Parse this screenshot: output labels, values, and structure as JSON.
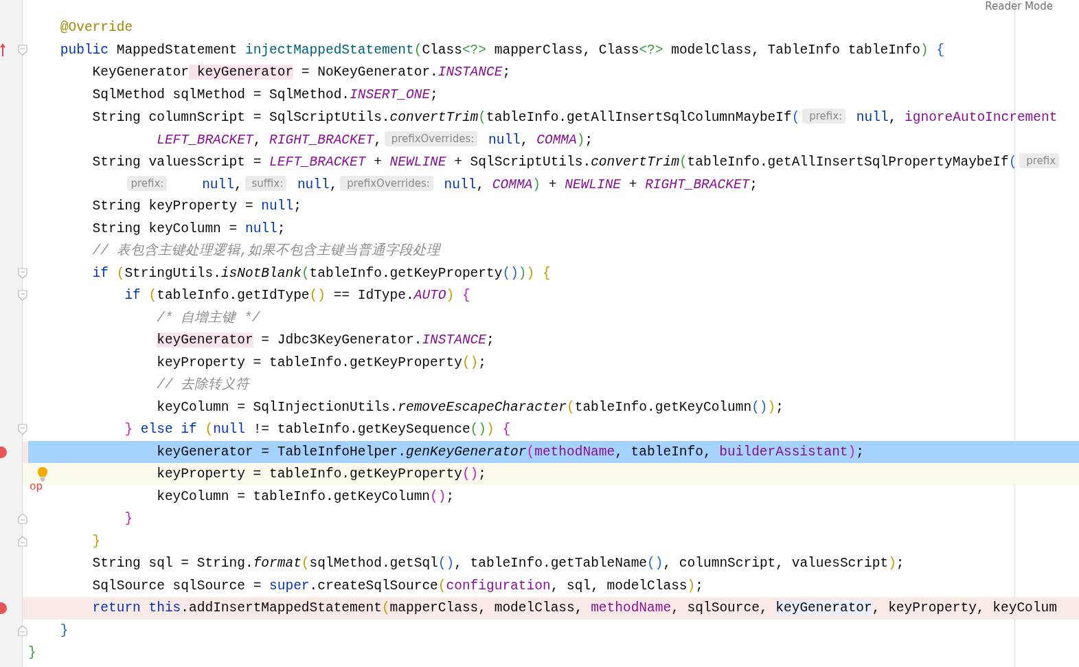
{
  "toolbar": {
    "reader_mode": "Reader Mode"
  },
  "lines": [
    {
      "tokens": [
        {
          "text": "@Override",
          "kind": "annotation"
        }
      ]
    },
    {
      "override": true,
      "fold_start": true,
      "tokens": [
        {
          "text": "public",
          "kind": "keyword"
        },
        {
          "text": " MappedStatement",
          "kind": "plain"
        },
        {
          "text": " injectMappedStatement",
          "kind": "decl"
        },
        {
          "text": "(",
          "kind": "bracket",
          "color": "#3b9c3b"
        },
        {
          "text": "Class",
          "kind": "plain"
        },
        {
          "text": "<?>",
          "kind": "bracket",
          "color": "#3b9c3b"
        },
        {
          "text": " mapperClass, Class",
          "kind": "plain"
        },
        {
          "text": "<?>",
          "kind": "bracket",
          "color": "#3b9c3b"
        },
        {
          "text": " modelClass, TableInfo tableInfo",
          "kind": "plain"
        },
        {
          "text": ")",
          "kind": "bracket",
          "color": "#3b9c3b"
        },
        {
          "text": " {",
          "kind": "bracket",
          "color": "#2060d0"
        }
      ],
      "children": [
        {
          "tokens": [
            {
              "text": "KeyGenerator",
              "kind": "plain"
            },
            {
              "text": " keyGenerator",
              "kind": "write-usage"
            },
            {
              "text": " = NoKeyGenerator.",
              "kind": "plain"
            },
            {
              "text": "INSTANCE",
              "kind": "constant"
            },
            {
              "text": ";",
              "kind": "plain"
            }
          ]
        },
        {
          "tokens": [
            {
              "text": "SqlMethod sqlMethod = SqlMethod.",
              "kind": "plain"
            },
            {
              "text": "INSERT_ONE",
              "kind": "constant"
            },
            {
              "text": ";",
              "kind": "plain"
            }
          ]
        },
        {
          "tokens": [
            {
              "text": "String columnScript = SqlScriptUtils.",
              "kind": "plain"
            },
            {
              "text": "convertTrim",
              "kind": "static-call"
            },
            {
              "text": "(",
              "kind": "bracket",
              "color": "#3b9c3b"
            },
            {
              "text": "tableInfo.getAllInsertSqlColumnMaybeIf",
              "kind": "plain"
            },
            {
              "text": "(",
              "kind": "bracket",
              "color": "#2060d0"
            },
            {
              "text": " prefix:",
              "kind": "hint"
            },
            {
              "text": " null",
              "kind": "keyword"
            },
            {
              "text": ",",
              "kind": "plain"
            },
            {
              "text": " ignoreAutoIncrement",
              "kind": "field"
            }
          ],
          "children": [
            {
              "tokens": [
                {
                  "text": "    LEFT_BRACKET",
                  "kind": "constant"
                },
                {
                  "text": ",",
                  "kind": "plain"
                },
                {
                  "text": " RIGHT_BRACKET",
                  "kind": "constant"
                },
                {
                  "text": ",",
                  "kind": "plain"
                },
                {
                  "text": " prefixOverrides:",
                  "kind": "hint"
                },
                {
                  "text": " null",
                  "kind": "keyword"
                },
                {
                  "text": ",",
                  "kind": "plain"
                },
                {
                  "text": " COMMA",
                  "kind": "constant"
                },
                {
                  "text": ")",
                  "kind": "bracket",
                  "color": "#3b9c3b"
                },
                {
                  "text": ";",
                  "kind": "plain"
                }
              ]
            }
          ]
        },
        {
          "tokens": [
            {
              "text": "String valuesScript = ",
              "kind": "plain"
            },
            {
              "text": "LEFT_BRACKET",
              "kind": "constant"
            },
            {
              "text": " + ",
              "kind": "plain"
            },
            {
              "text": "NEWLINE",
              "kind": "constant"
            },
            {
              "text": " + SqlScriptUtils.",
              "kind": "plain"
            },
            {
              "text": "convertTrim",
              "kind": "static-call"
            },
            {
              "text": "(",
              "kind": "bracket",
              "color": "#3b9c3b"
            },
            {
              "text": "tableInfo.getAllInsertSqlPropertyMaybeIf",
              "kind": "plain"
            },
            {
              "text": "(",
              "kind": "bracket",
              "color": "#2060d0"
            },
            {
              "text": " prefix",
              "kind": "hint"
            }
          ],
          "children": [
            {
              "tokens": [
                {
                  "text": "prefix:",
                  "kind": "hint"
                },
                {
                  "text": "    null",
                  "kind": "keyword"
                },
                {
                  "text": ",",
                  "kind": "plain"
                },
                {
                  "text": " suffix:",
                  "kind": "hint"
                },
                {
                  "text": " null",
                  "kind": "keyword"
                },
                {
                  "text": ",",
                  "kind": "plain"
                },
                {
                  "text": " prefixOverrides:",
                  "kind": "hint"
                },
                {
                  "text": " null",
                  "kind": "keyword"
                },
                {
                  "text": ",",
                  "kind": "plain"
                },
                {
                  "text": " COMMA",
                  "kind": "constant"
                },
                {
                  "text": ")",
                  "kind": "bracket",
                  "color": "#3b9c3b"
                },
                {
                  "text": " + ",
                  "kind": "plain"
                },
                {
                  "text": "NEWLINE",
                  "kind": "constant"
                },
                {
                  "text": " + ",
                  "kind": "plain"
                },
                {
                  "text": "RIGHT_BRACKET",
                  "kind": "constant"
                },
                {
                  "text": ";",
                  "kind": "plain"
                }
              ]
            }
          ]
        },
        {
          "tokens": [
            {
              "text": "String keyProperty = ",
              "kind": "plain"
            },
            {
              "text": "null",
              "kind": "keyword"
            },
            {
              "text": ";",
              "kind": "plain"
            }
          ]
        },
        {
          "tokens": [
            {
              "text": "String keyColumn = ",
              "kind": "plain"
            },
            {
              "text": "null",
              "kind": "keyword"
            },
            {
              "text": ";",
              "kind": "plain"
            }
          ]
        },
        {
          "tokens": [
            {
              "text": "// 表包含主键处理逻辑,如果不包含主键当普通字段处理",
              "kind": "comment"
            }
          ]
        },
        {
          "fold_start": true,
          "tokens": [
            {
              "text": "if",
              "kind": "keyword"
            },
            {
              "text": " (",
              "kind": "bracket",
              "color": "#c49a00"
            },
            {
              "text": "StringUtils.",
              "kind": "plain"
            },
            {
              "text": "isNotBlank",
              "kind": "static-call"
            },
            {
              "text": "(",
              "kind": "bracket",
              "color": "#3b9c3b"
            },
            {
              "text": "tableInfo.getKeyProperty",
              "kind": "plain"
            },
            {
              "text": "()",
              "kind": "bracket",
              "color": "#2060d0"
            },
            {
              "text": ")",
              "kind": "bracket",
              "color": "#3b9c3b"
            },
            {
              "text": ")",
              "kind": "bracket",
              "color": "#c49a00"
            },
            {
              "text": " {",
              "kind": "bracket",
              "color": "#c49a00"
            }
          ],
          "children": [
            {
              "fold_start": true,
              "tokens": [
                {
                  "text": "if",
                  "kind": "keyword"
                },
                {
                  "text": " (",
                  "kind": "bracket",
                  "color": "#c49a00"
                },
                {
                  "text": "tableInfo.getIdType",
                  "kind": "plain"
                },
                {
                  "text": "()",
                  "kind": "bracket",
                  "color": "#c49a00"
                },
                {
                  "text": " == IdType.",
                  "kind": "plain"
                },
                {
                  "text": "AUTO",
                  "kind": "constant"
                },
                {
                  "text": ")",
                  "kind": "bracket",
                  "color": "#c49a00"
                },
                {
                  "text": " {",
                  "kind": "bracket",
                  "color": "#c020c0"
                }
              ],
              "children": [
                {
                  "tokens": [
                    {
                      "text": "/* 自增主键 */",
                      "kind": "comment"
                    }
                  ]
                },
                {
                  "tokens": [
                    {
                      "text": "keyGenerator",
                      "kind": "write-usage"
                    },
                    {
                      "text": " = Jdbc3KeyGenerator.",
                      "kind": "plain"
                    },
                    {
                      "text": "INSTANCE",
                      "kind": "constant"
                    },
                    {
                      "text": ";",
                      "kind": "plain"
                    }
                  ]
                },
                {
                  "tokens": [
                    {
                      "text": "keyProperty = tableInfo.getKeyProperty",
                      "kind": "plain"
                    },
                    {
                      "text": "()",
                      "kind": "bracket",
                      "color": "#c49a00"
                    },
                    {
                      "text": ";",
                      "kind": "plain"
                    }
                  ]
                },
                {
                  "tokens": [
                    {
                      "text": "// 去除转义符",
                      "kind": "comment"
                    }
                  ]
                },
                {
                  "tokens": [
                    {
                      "text": "keyColumn = SqlInjectionUtils.",
                      "kind": "plain"
                    },
                    {
                      "text": "removeEscapeCharacter",
                      "kind": "static-call"
                    },
                    {
                      "text": "(",
                      "kind": "bracket",
                      "color": "#c49a00"
                    },
                    {
                      "text": "tableInfo.getKeyColumn",
                      "kind": "plain"
                    },
                    {
                      "text": "()",
                      "kind": "bracket",
                      "color": "#2060d0"
                    },
                    {
                      "text": ")",
                      "kind": "bracket",
                      "color": "#c49a00"
                    },
                    {
                      "text": ";",
                      "kind": "plain"
                    }
                  ]
                }
              ]
            },
            {
              "fold_start": true,
              "tokens": [
                {
                  "text": "}",
                  "kind": "bracket",
                  "color": "#c020c0"
                },
                {
                  "text": " else if",
                  "kind": "keyword"
                },
                {
                  "text": " (",
                  "kind": "bracket",
                  "color": "#c49a00"
                },
                {
                  "text": "null",
                  "kind": "keyword"
                },
                {
                  "text": " != tableInfo.getKeySequence",
                  "kind": "plain"
                },
                {
                  "text": "()",
                  "kind": "bracket",
                  "color": "#3b9c3b"
                },
                {
                  "text": ")",
                  "kind": "bracket",
                  "color": "#c49a00"
                },
                {
                  "text": " {",
                  "kind": "bracket",
                  "color": "#c020c0"
                }
              ],
              "children": [
                {
                  "breakpoint": true,
                  "execution_point": true,
                  "tokens": [
                    {
                      "text": "keyGenerator = TableInfoHelper.",
                      "kind": "plain"
                    },
                    {
                      "text": "genKeyGenerator",
                      "kind": "static-call"
                    },
                    {
                      "text": "(",
                      "kind": "bracket",
                      "color": "#c020c0"
                    },
                    {
                      "text": "methodName",
                      "kind": "field"
                    },
                    {
                      "text": ", tableInfo, ",
                      "kind": "plain"
                    },
                    {
                      "text": "builderAssistant",
                      "kind": "field"
                    },
                    {
                      "text": ")",
                      "kind": "bracket",
                      "color": "#c020c0"
                    },
                    {
                      "text": ";",
                      "kind": "plain"
                    }
                  ]
                },
                {
                  "intention": true,
                  "caret_line": true,
                  "note": "op",
                  "tokens": [
                    {
                      "text": "keyProperty = tableInfo.getKeyProperty",
                      "kind": "plain"
                    },
                    {
                      "text": "()",
                      "kind": "bracket",
                      "color": "#c020c0"
                    },
                    {
                      "text": ";",
                      "kind": "plain"
                    }
                  ]
                },
                {
                  "tokens": [
                    {
                      "text": "keyColumn = tableInfo.getKeyColumn",
                      "kind": "plain"
                    },
                    {
                      "text": "()",
                      "kind": "bracket",
                      "color": "#c020c0"
                    },
                    {
                      "text": ";",
                      "kind": "plain"
                    }
                  ]
                }
              ]
            },
            {
              "fold_end": true,
              "tokens": [
                {
                  "text": "}",
                  "kind": "bracket",
                  "color": "#c020c0"
                }
              ]
            }
          ]
        },
        {
          "fold_end": true,
          "tokens": [
            {
              "text": "}",
              "kind": "bracket",
              "color": "#c49a00"
            }
          ]
        },
        {
          "tokens": [
            {
              "text": "String sql = String.",
              "kind": "plain"
            },
            {
              "text": "format",
              "kind": "static-call"
            },
            {
              "text": "(",
              "kind": "bracket",
              "color": "#c49a00"
            },
            {
              "text": "sqlMethod.getSql",
              "kind": "plain"
            },
            {
              "text": "()",
              "kind": "bracket",
              "color": "#2060d0"
            },
            {
              "text": ", tableInfo.getTableName",
              "kind": "plain"
            },
            {
              "text": "()",
              "kind": "bracket",
              "color": "#2060d0"
            },
            {
              "text": ", columnScript, valuesScript",
              "kind": "plain"
            },
            {
              "text": ")",
              "kind": "bracket",
              "color": "#c49a00"
            },
            {
              "text": ";",
              "kind": "plain"
            }
          ]
        },
        {
          "tokens": [
            {
              "text": "SqlSource sqlSource = ",
              "kind": "plain"
            },
            {
              "text": "super",
              "kind": "keyword"
            },
            {
              "text": ".createSqlSource",
              "kind": "plain"
            },
            {
              "text": "(",
              "kind": "bracket",
              "color": "#c49a00"
            },
            {
              "text": "configuration",
              "kind": "field"
            },
            {
              "text": ", sql, modelClass",
              "kind": "plain"
            },
            {
              "text": ")",
              "kind": "bracket",
              "color": "#c49a00"
            },
            {
              "text": ";",
              "kind": "plain"
            }
          ]
        },
        {
          "breakpoint": true,
          "tokens": [
            {
              "text": "return",
              "kind": "keyword"
            },
            {
              "text": " this",
              "kind": "keyword"
            },
            {
              "text": ".addInsertMappedStatement",
              "kind": "plain"
            },
            {
              "text": "(",
              "kind": "bracket",
              "color": "#c49a00"
            },
            {
              "text": "mapperClass, modelClass, ",
              "kind": "plain"
            },
            {
              "text": "methodName",
              "kind": "field"
            },
            {
              "text": ", sqlSource, ",
              "kind": "plain"
            },
            {
              "text": "keyGenerator",
              "kind": "read-usage"
            },
            {
              "text": ", keyProperty, keyColum",
              "kind": "plain"
            }
          ]
        }
      ]
    },
    {
      "fold_end": true,
      "tokens": [
        {
          "text": "}",
          "kind": "bracket",
          "color": "#2060d0"
        }
      ]
    }
  ],
  "class_end": {
    "tokens": [
      {
        "text": "}",
        "kind": "bracket",
        "color": "#3b9c3b"
      }
    ]
  }
}
